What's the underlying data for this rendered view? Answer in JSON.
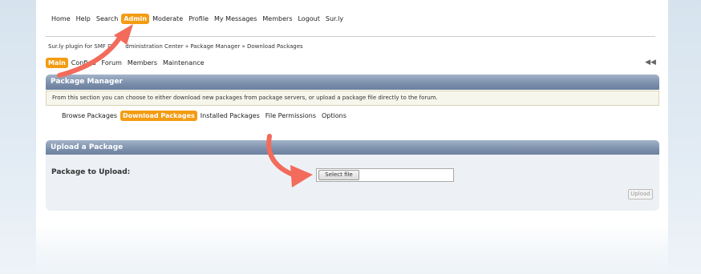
{
  "topnav": {
    "items": [
      {
        "label": "Home"
      },
      {
        "label": "Help"
      },
      {
        "label": "Search"
      },
      {
        "label": "Admin",
        "active": true
      },
      {
        "label": "Moderate"
      },
      {
        "label": "Profile"
      },
      {
        "label": "My Messages"
      },
      {
        "label": "Members"
      },
      {
        "label": "Logout"
      },
      {
        "label": "Sur.ly"
      }
    ]
  },
  "breadcrumb": {
    "text": "Sur.ly plugin for SMF D            dministration Center » Package Manager » Download Packages"
  },
  "adminnav": {
    "items": [
      {
        "label": "Main",
        "active": true
      },
      {
        "label": "Configu"
      },
      {
        "label": "Forum"
      },
      {
        "label": "Members"
      },
      {
        "label": "Maintenance"
      }
    ],
    "collapse_icon": "collapse-icon"
  },
  "package_manager": {
    "title": "Package Manager",
    "info": "From this section you can choose to either download new packages from package servers, or upload a package file directly to the forum.",
    "tabs": [
      {
        "label": "Browse Packages"
      },
      {
        "label": "Download Packages",
        "active": true
      },
      {
        "label": "Installed Packages"
      },
      {
        "label": "File Permissions"
      },
      {
        "label": "Options"
      }
    ]
  },
  "upload": {
    "title": "Upload a Package",
    "field_label": "Package to Upload:",
    "file_button": "Select file",
    "submit": "Upload"
  },
  "colors": {
    "accent": "#f39c12",
    "arrow": "#f26b5b",
    "header": "#7d91ad"
  }
}
